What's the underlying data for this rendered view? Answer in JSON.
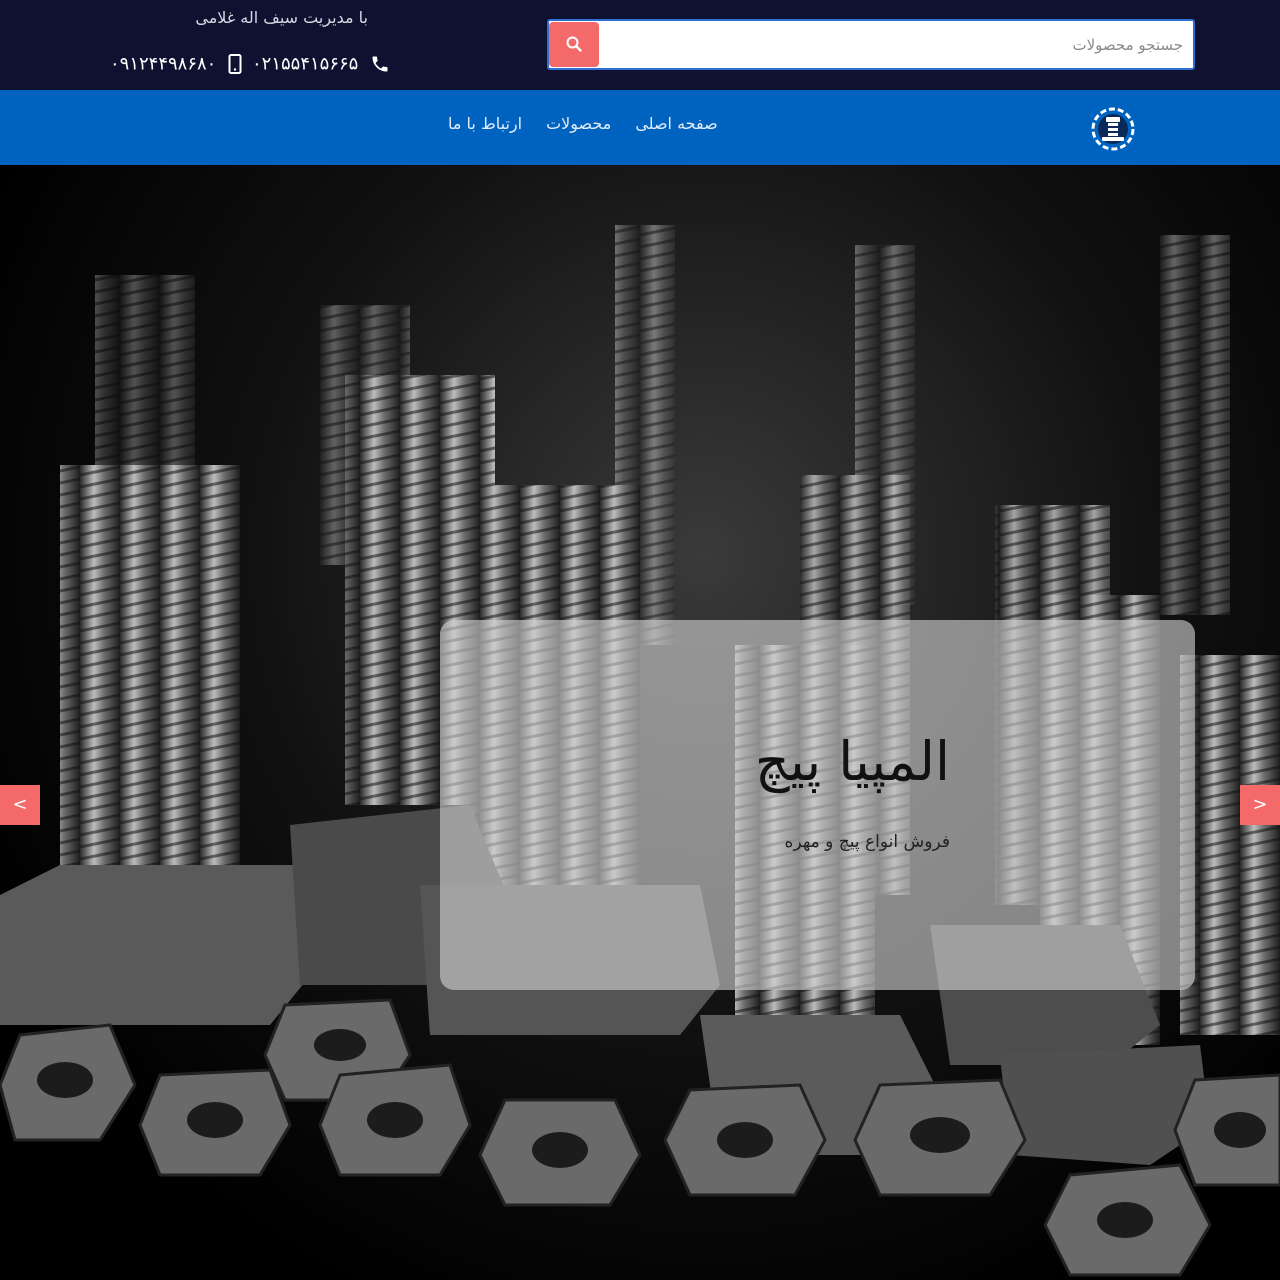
{
  "header": {
    "search": {
      "placeholder": "جستجو محصولات",
      "button_icon": "search-icon"
    },
    "manager_text": "با مدیریت سیف اله غلامی",
    "phone": {
      "number": "۰۲۱۵۵۴۱۵۶۶۵",
      "icon": "phone-icon"
    },
    "mobile": {
      "number": "۰۹۱۲۴۴۹۸۶۸۰",
      "icon": "mobile-icon"
    }
  },
  "nav": {
    "items": [
      {
        "label": "صفحه اصلی"
      },
      {
        "label": "محصولات"
      },
      {
        "label": "ارتباط با ما"
      }
    ],
    "logo_icon": "bolt-gear-logo"
  },
  "hero": {
    "title": "المپیا پیچ",
    "subtitle": "فروش انواع پیچ و مهره",
    "prev_label": "<",
    "next_label": ">"
  },
  "colors": {
    "topbar": "#0e1230",
    "navbar": "#0163c0",
    "accent": "#f46a6a"
  }
}
